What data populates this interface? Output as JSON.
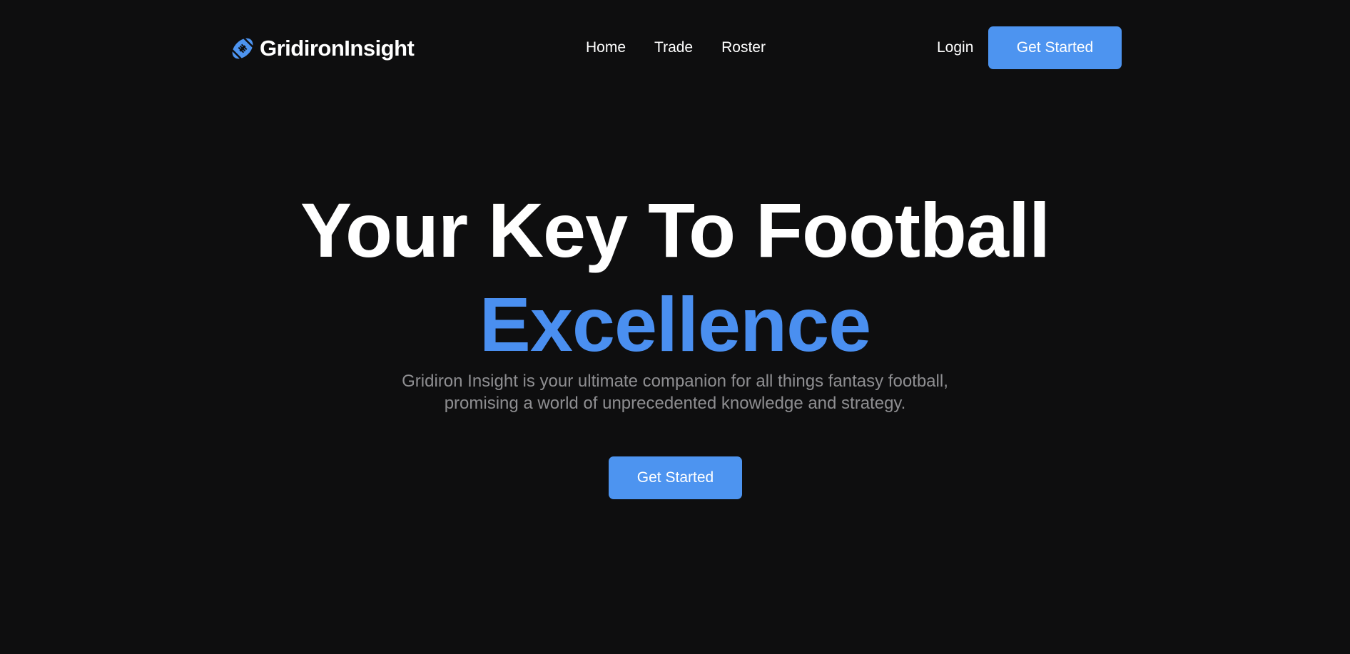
{
  "header": {
    "brand": {
      "name": "GridironInsight",
      "icon": "football-icon"
    },
    "nav": [
      {
        "label": "Home"
      },
      {
        "label": "Trade"
      },
      {
        "label": "Roster"
      }
    ],
    "login_label": "Login",
    "cta_label": "Get Started"
  },
  "hero": {
    "title_line1": "Your Key To Football",
    "title_line2": "Excellence",
    "subtitle_line1": "Gridiron Insight is your ultimate companion for all things fantasy football,",
    "subtitle_line2": "promising a world of unprecedented knowledge and strategy.",
    "cta_label": "Get Started"
  },
  "colors": {
    "background": "#0e0e0f",
    "accent": "#4d94f0",
    "text": "#ffffff",
    "muted": "#8e8e91"
  }
}
